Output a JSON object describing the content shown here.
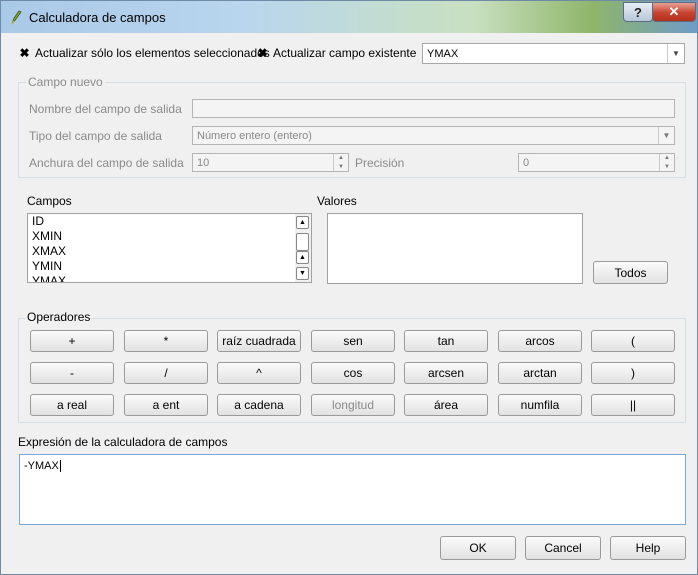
{
  "window": {
    "title": "Calculadora de campos",
    "help_glyph": "?",
    "close_glyph": "✕"
  },
  "options": {
    "update_selected_label": "Actualizar sólo los elementos seleccionados",
    "update_selected_checked": true,
    "update_existing_label": "Actualizar campo existente",
    "update_existing_checked": true,
    "existing_field_value": "YMAX"
  },
  "new_field": {
    "group_title": "Campo nuevo",
    "output_name_label": "Nombre del campo de salida",
    "output_name_value": "",
    "type_label": "Tipo del campo de salida",
    "type_value": "Número entero (entero)",
    "width_label": "Anchura del campo de salida",
    "width_value": "10",
    "precision_label": "Precisión",
    "precision_value": "0"
  },
  "fields": {
    "label": "Campos",
    "items": [
      "ID",
      "XMIN",
      "XMAX",
      "YMIN",
      "YMAX"
    ]
  },
  "values": {
    "label": "Valores",
    "all_button": "Todos"
  },
  "operators": {
    "group_title": "Operadores",
    "rows": [
      [
        "+",
        "*",
        "raíz cuadrada",
        "sen",
        "tan",
        "arcos",
        "("
      ],
      [
        "-",
        "/",
        "^",
        "cos",
        "arcsen",
        "arctan",
        ")"
      ],
      [
        "a real",
        "a ent",
        "a cadena",
        "longitud",
        "área",
        "numfila",
        "||"
      ]
    ],
    "disabled": [
      "longitud"
    ]
  },
  "expression": {
    "label": "Expresión de la calculadora de campos",
    "value": "-YMAX"
  },
  "footer": {
    "ok": "OK",
    "cancel": "Cancel",
    "help": "Help"
  }
}
